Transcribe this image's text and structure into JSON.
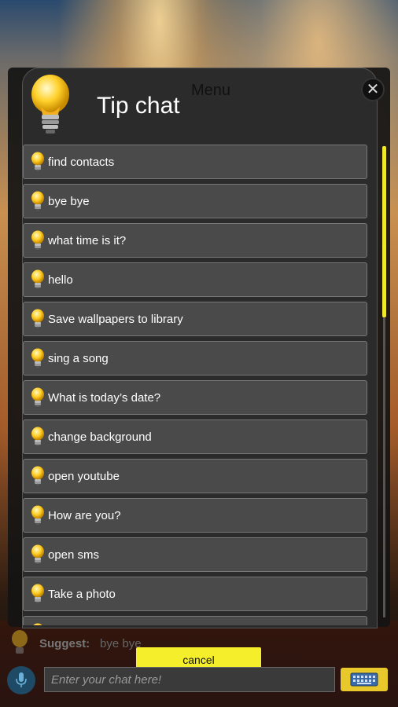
{
  "dialog": {
    "title": "Tip chat",
    "menu_label": "Menu",
    "close_symbol": "✕",
    "items": [
      {
        "label": "find contacts"
      },
      {
        "label": "bye bye"
      },
      {
        "label": "what time is it?"
      },
      {
        "label": "hello"
      },
      {
        "label": "Save wallpapers to library"
      },
      {
        "label": "sing a song"
      },
      {
        "label": "What is today’s date?"
      },
      {
        "label": "change background"
      },
      {
        "label": "open youtube"
      },
      {
        "label": "How are you?"
      },
      {
        "label": "open sms"
      },
      {
        "label": "Take a photo"
      },
      {
        "label": ""
      }
    ]
  },
  "bottom": {
    "suggest_label": "Suggest:",
    "suggest_value": "bye bye",
    "cancel_label": "cancel",
    "chat_placeholder": "Enter your chat here!"
  },
  "colors": {
    "accent_yellow": "#f5ee2a",
    "scroll_thumb": "#f0e82a",
    "item_bg": "#4a4a4a"
  },
  "icons": {
    "bulb": "lightbulb-icon",
    "close": "close-icon",
    "mic": "microphone-icon",
    "keyboard": "keyboard-icon"
  }
}
